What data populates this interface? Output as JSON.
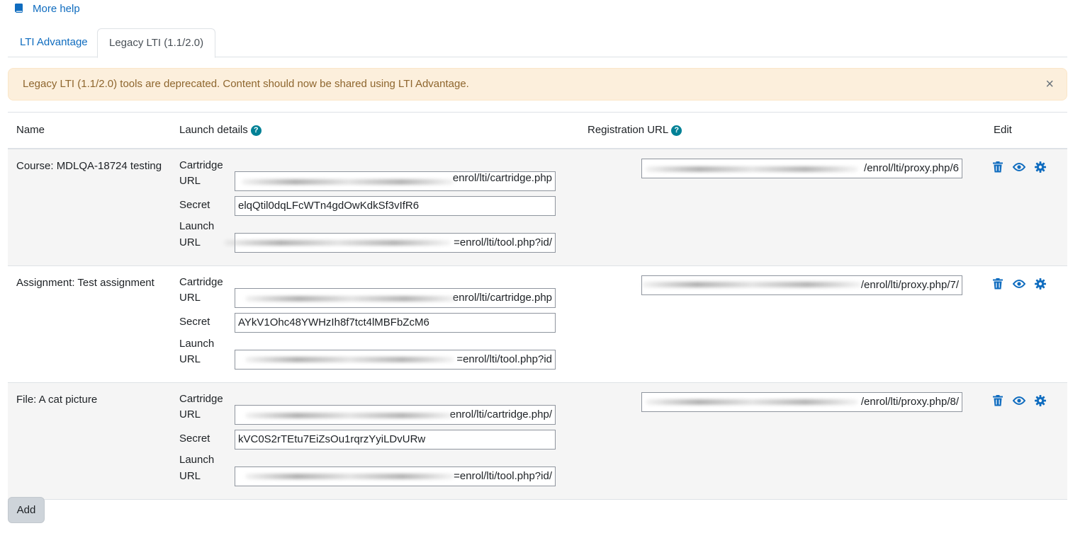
{
  "help": {
    "label": "More help"
  },
  "tabs": [
    {
      "label": "LTI Advantage",
      "active": false
    },
    {
      "label": "Legacy LTI (1.1/2.0)",
      "active": true
    }
  ],
  "alert": {
    "message": "Legacy LTI (1.1/2.0) tools are deprecated. Content should now be shared using LTI Advantage.",
    "close": "×"
  },
  "table": {
    "headers": {
      "name": "Name",
      "launch": "Launch details",
      "registration": "Registration URL",
      "edit": "Edit"
    },
    "labels": {
      "cartridge_1": "Cartridge",
      "cartridge_2": "URL",
      "secret": "Secret",
      "launch_1": "Launch",
      "launch_2": "URL"
    },
    "rows": [
      {
        "name": "Course: MDLQA-18724 testing",
        "cartridge_url": "enrol/lti/cartridge.php",
        "secret": "elqQtil0dqLFcWTn4gdOwKdkSf3vIfR6",
        "launch_url": "/enrol/lti/tool.php?id=",
        "registration_url": "enrol/lti/proxy.php/6/"
      },
      {
        "name": "Assignment: Test assignment",
        "cartridge_url": "enrol/lti/cartridge.php",
        "secret": "AYkV1Ohc48YWHzIh8f7tct4lMBFbZcM6",
        "launch_url": "enrol/lti/tool.php?id=",
        "registration_url": "/enrol/lti/proxy.php/7/"
      },
      {
        "name": "File: A cat picture",
        "cartridge_url": "/enrol/lti/cartridge.php",
        "secret": "kVC0S2rTEtu7EiZsOu1rqrzYyiLDvURw",
        "launch_url": "/enrol/lti/tool.php?id=",
        "registration_url": "/enrol/lti/proxy.php/8/"
      }
    ]
  },
  "buttons": {
    "add": "Add"
  },
  "colors": {
    "link": "#0f6cbf",
    "alert_bg": "#fcefdc",
    "alert_text": "#8e662e",
    "help_icon": "#008196"
  },
  "icons": {
    "help": "book-icon",
    "delete": "trash-icon",
    "view": "eye-icon",
    "settings": "gear-icon",
    "info": "question-circle-icon"
  }
}
